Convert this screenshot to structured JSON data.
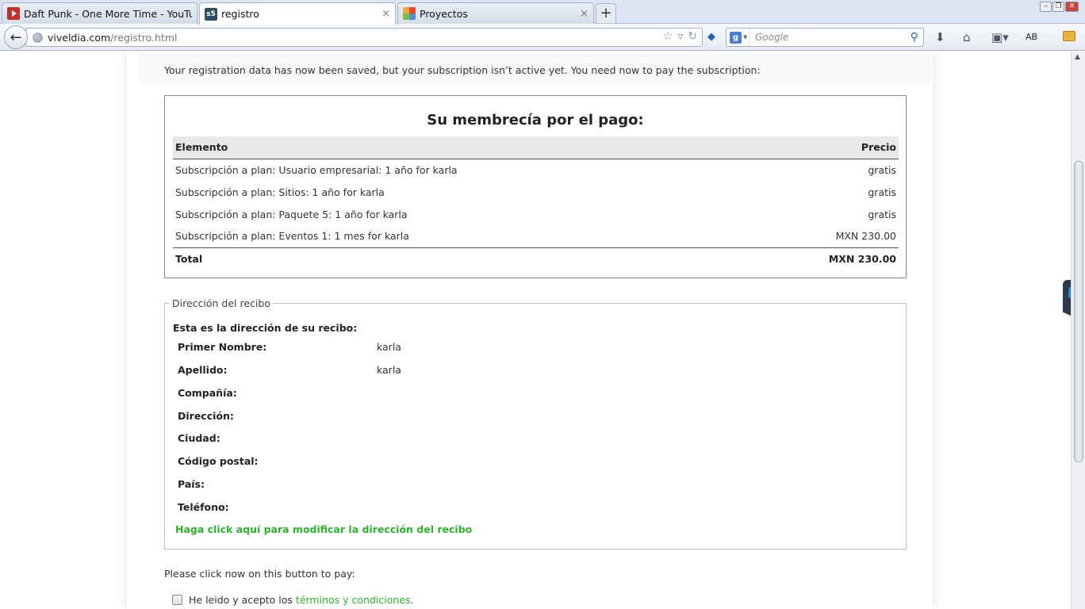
{
  "browser": {
    "tabs": [
      {
        "title": "Daft Punk - One More Time - YouTube",
        "favicon": "youtube-icon",
        "active": false
      },
      {
        "title": "registro",
        "favicon": "s5-icon",
        "active": true
      },
      {
        "title": "Proyectos",
        "favicon": "joomla-icon",
        "active": false
      }
    ],
    "new_tab": "+",
    "tab_close": "×",
    "url_host": "viveldia.com",
    "url_path": "/registro.html",
    "search_placeholder": "Google",
    "search_engine_logo": "g",
    "profile_label": "AB"
  },
  "page": {
    "notice": "Your registration data has now been saved, but your subscription isn’t active yet. You need now to pay the subscription:",
    "membership": {
      "title": "Su membrecía por el pago:",
      "col_item": "Elemento",
      "col_price": "Precio",
      "rows": [
        {
          "item": "Subscripción a plan: Usuario empresarial: 1 año for karla",
          "price": "gratis"
        },
        {
          "item": "Subscripción a plan: Sitios: 1 año for karla",
          "price": "gratis"
        },
        {
          "item": "Subscripción a plan: Paquete 5: 1 año for karla",
          "price": "gratis"
        },
        {
          "item": "Subscripción a plan: Eventos 1: 1 mes for karla",
          "price": "MXN 230.00"
        }
      ],
      "total_label": "Total",
      "total_value": "MXN 230.00"
    },
    "address": {
      "legend": "Dirección del recibo",
      "intro": "Esta es la dirección de su recibo:",
      "fields": [
        {
          "label": "Primer Nombre:",
          "value": "karla"
        },
        {
          "label": "Apellido:",
          "value": "karla"
        },
        {
          "label": "Compañía:",
          "value": ""
        },
        {
          "label": "Dirección:",
          "value": ""
        },
        {
          "label": "Ciudad:",
          "value": ""
        },
        {
          "label": "Código postal:",
          "value": ""
        },
        {
          "label": "País:",
          "value": ""
        },
        {
          "label": "Teléfono:",
          "value": ""
        }
      ],
      "edit_link": "Haga click aquí para modificar la dirección del recibo"
    },
    "pay_note": "Please click now on this button to pay:",
    "terms": {
      "prefix": "He leido y acepto los ",
      "link": "términos y condiciones",
      "suffix": ".",
      "checked": false
    },
    "colors": {
      "link_green": "#2db22d"
    }
  }
}
